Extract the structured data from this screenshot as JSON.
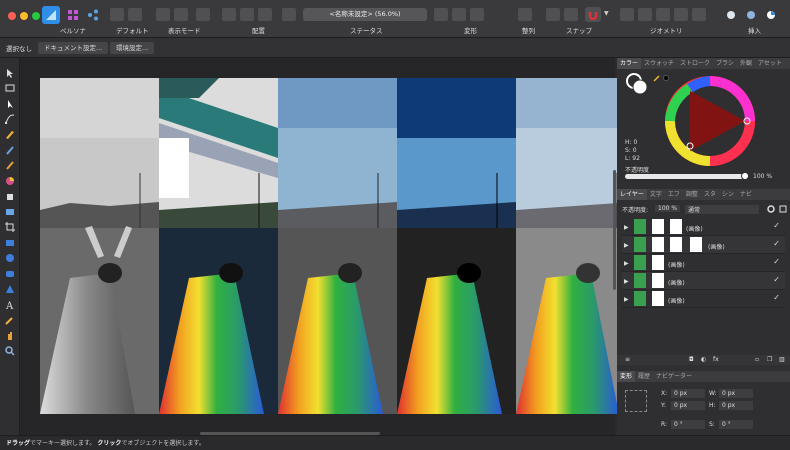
{
  "toolbar": {
    "persona_label": "ペルソナ",
    "default_label": "デフォルト",
    "view_mode_label": "表示モード",
    "arrange_label": "配置",
    "status_label": "ステータス",
    "status_value": "<名称未設定> (56.0%)",
    "transform_label": "変形",
    "align_label": "整列",
    "snap_label": "スナップ",
    "geometry_label": "ジオメトリ",
    "insert_label": "挿入"
  },
  "context_bar": {
    "selection_none": "選択なし",
    "document_settings": "ドキュメント設定...",
    "environment_settings": "環境設定..."
  },
  "color_panel": {
    "tabs": [
      "カラー",
      "スウォッチ",
      "ストローク",
      "ブラシ",
      "外観",
      "アセット"
    ],
    "h": "H: 0",
    "s": "S: 0",
    "l": "L: 92",
    "opacity_label": "不透明度",
    "opacity_value": "100 %"
  },
  "layers_panel": {
    "tabs": [
      "レイヤー",
      "文字",
      "エフ",
      "調整",
      "スタ",
      "シン",
      "ナビ"
    ],
    "opacity_label": "不透明度:",
    "opacity_value": "100 %",
    "blend_mode": "通常",
    "layers": [
      {
        "name": "(画像)",
        "visible": "✓"
      },
      {
        "name": "(画像)",
        "visible": "✓"
      },
      {
        "name": "(画像)",
        "visible": "✓"
      },
      {
        "name": "(画像)",
        "visible": "✓"
      },
      {
        "name": "(画像)",
        "visible": "✓"
      }
    ]
  },
  "transform_panel": {
    "tabs": [
      "変形",
      "履歴",
      "ナビゲーター"
    ],
    "x": "X:",
    "x_val": "0 px",
    "y": "Y:",
    "y_val": "0 px",
    "w": "W:",
    "w_val": "0 px",
    "h": "H:",
    "h_val": "0 px",
    "r": "R:",
    "r_val": "0 °",
    "s": "S:",
    "s_val": "0 °"
  },
  "status_bar": {
    "drag_bold": "ドラッグ",
    "drag_text": "でマーキー選択します。",
    "click_bold": "クリック",
    "click_text": "でオブジェクトを選択します。"
  }
}
